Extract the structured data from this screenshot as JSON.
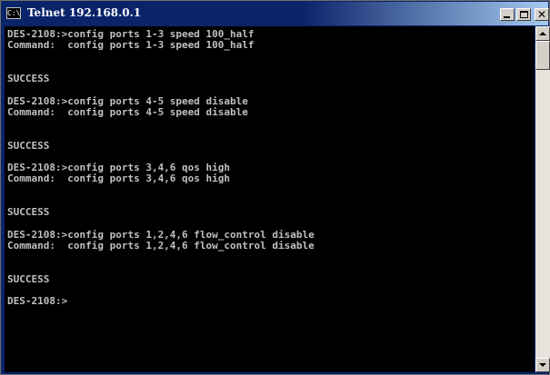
{
  "window": {
    "title": "Telnet 192.168.0.1",
    "icon_label": "C:\\",
    "icon": "console-icon",
    "buttons": {
      "minimize": "minimize-icon",
      "maximize": "maximize-icon",
      "close": "close-icon",
      "close_glyph": "✕"
    }
  },
  "console": {
    "background": "#000000",
    "foreground": "#c0c0c0",
    "lines": [
      "DES-2108:>config ports 1-3 speed 100_half",
      "Command:  config ports 1-3 speed 100_half",
      "",
      "",
      "SUCCESS",
      "",
      "DES-2108:>config ports 4-5 speed disable",
      "Command:  config ports 4-5 speed disable",
      "",
      "",
      "SUCCESS",
      "",
      "DES-2108:>config ports 3,4,6 qos high",
      "Command:  config ports 3,4,6 qos high",
      "",
      "",
      "SUCCESS",
      "",
      "DES-2108:>config ports 1,2,4,6 flow_control disable",
      "Command:  config ports 1,2,4,6 flow_control disable",
      "",
      "",
      "SUCCESS",
      "",
      "DES-2108:>"
    ]
  },
  "scrollbar": {
    "up_icon": "scroll-up-arrow-icon",
    "down_icon": "scroll-down-arrow-icon"
  }
}
